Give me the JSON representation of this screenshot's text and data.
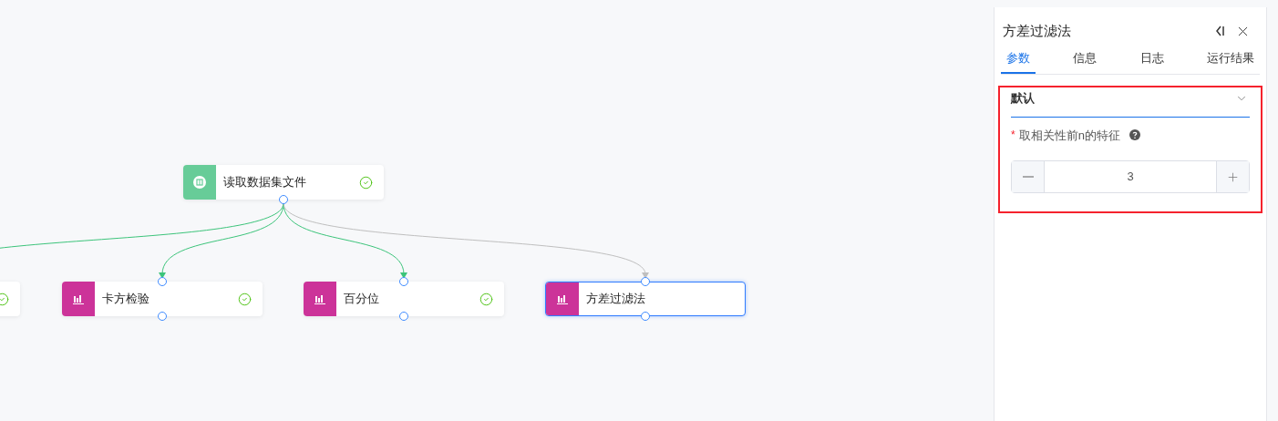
{
  "canvas": {
    "nodes": [
      {
        "kind": "source",
        "label": "读取数据集文件",
        "done": true,
        "selected": false
      },
      {
        "kind": "stat",
        "done": true,
        "selected": false
      },
      {
        "kind": "stat",
        "label": "卡方检验",
        "done": true,
        "selected": false
      },
      {
        "kind": "stat",
        "label": "百分位",
        "done": true,
        "selected": false
      },
      {
        "kind": "stat",
        "label": "方差过滤法",
        "done": false,
        "selected": true
      }
    ]
  },
  "panel": {
    "title": "方差过滤法",
    "tabs": [
      {
        "label": "参数",
        "selected": true
      },
      {
        "label": "信息",
        "selected": false
      },
      {
        "label": "日志",
        "selected": false
      },
      {
        "label": "运行结果",
        "selected": false
      }
    ],
    "params": {
      "highlighted": true,
      "preset": "默认",
      "field": {
        "label": "取相关性前n的特征",
        "required_mark": "*",
        "value": "3"
      }
    }
  }
}
